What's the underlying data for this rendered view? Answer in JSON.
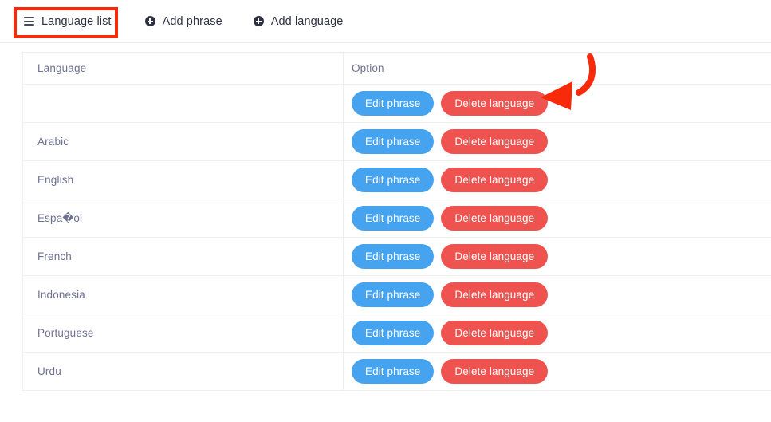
{
  "toolbar": {
    "tabs": [
      {
        "label": "Language list",
        "icon": "hamburger-icon",
        "active": true
      },
      {
        "label": "Add phrase",
        "icon": "plus-circle-icon",
        "active": false
      },
      {
        "label": "Add language",
        "icon": "plus-circle-icon",
        "active": false
      }
    ]
  },
  "table": {
    "columns": [
      "Language",
      "Option"
    ],
    "actions": {
      "edit_label": "Edit phrase",
      "delete_label": "Delete language"
    },
    "rows": [
      {
        "language": ""
      },
      {
        "language": "Arabic"
      },
      {
        "language": "English"
      },
      {
        "language": "Espa�ol"
      },
      {
        "language": "French"
      },
      {
        "language": "Indonesia"
      },
      {
        "language": "Portuguese"
      },
      {
        "language": "Urdu"
      }
    ]
  },
  "annotations": {
    "highlight_target": "Language list",
    "arrow_target": "Delete language",
    "color": "#f92a0a"
  },
  "colors": {
    "edit_button": "#45a3ef",
    "delete_button": "#ef5350",
    "text_muted": "#6e7191",
    "text_dark": "#2d3142",
    "border": "#eeeeee",
    "annotation_red": "#f92a0a"
  }
}
